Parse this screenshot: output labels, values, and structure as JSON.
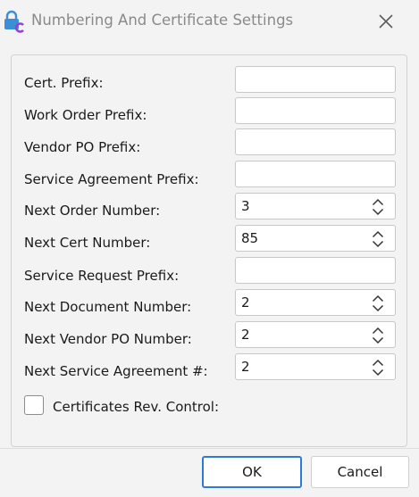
{
  "window": {
    "title": "Numbering And Certificate Settings",
    "app_icon": "lock-c-app-icon",
    "close_icon": "close-icon"
  },
  "form": {
    "cert_prefix": {
      "label": "Cert. Prefix:",
      "value": ""
    },
    "work_order_prefix": {
      "label": "Work Order Prefix:",
      "value": ""
    },
    "vendor_po_prefix": {
      "label": "Vendor PO Prefix:",
      "value": ""
    },
    "service_agreement_prefix": {
      "label": "Service Agreement Prefix:",
      "value": ""
    },
    "next_order_number": {
      "label": "Next Order Number:",
      "value": "3"
    },
    "next_cert_number": {
      "label": "Next Cert Number:",
      "value": "85"
    },
    "service_request_prefix": {
      "label": "Service Request Prefix:",
      "value": ""
    },
    "next_document_number": {
      "label": "Next Document Number:",
      "value": "2"
    },
    "next_vendor_po_number": {
      "label": "Next Vendor PO Number:",
      "value": "2"
    },
    "next_service_agreement_number": {
      "label": "Next Service Agreement #:",
      "value": "2"
    },
    "certificates_rev_control": {
      "label": "Certificates Rev. Control:",
      "checked": false
    }
  },
  "buttons": {
    "ok": "OK",
    "cancel": "Cancel"
  },
  "colors": {
    "accent": "#2c7bd6",
    "icon_blue": "#3a8fd6",
    "icon_purple": "#9b3fd0"
  }
}
